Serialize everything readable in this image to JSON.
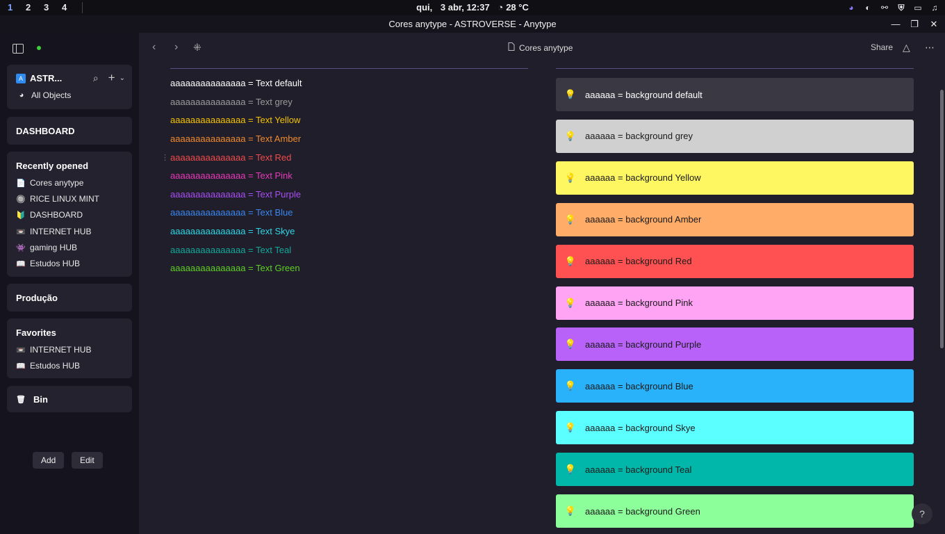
{
  "system_bar": {
    "workspaces": [
      "1",
      "2",
      "3",
      "4"
    ],
    "day": "qui,",
    "date": "3 abr, 12:37",
    "weather": "28 °C"
  },
  "window": {
    "title": "Cores anytype - ASTROVERSE - Anytype",
    "minimize": "—",
    "maximize": "❐",
    "close": "✕"
  },
  "sidebar": {
    "space_name": "ASTR...",
    "all_objects": "All Objects",
    "dashboard": "DASHBOARD",
    "recent_title": "Recently opened",
    "recent": [
      {
        "icon": "📄",
        "label": "Cores anytype"
      },
      {
        "icon": "🔘",
        "label": "RICE LINUX MINT"
      },
      {
        "icon": "🔰",
        "label": "DASHBOARD"
      },
      {
        "icon": "📼",
        "label": "INTERNET HUB"
      },
      {
        "icon": "👾",
        "label": "gaming HUB"
      },
      {
        "icon": "📖",
        "label": "Estudos HUB"
      }
    ],
    "producao": "Produção",
    "favorites_title": "Favorites",
    "favorites": [
      {
        "icon": "📼",
        "label": "INTERNET HUB"
      },
      {
        "icon": "📖",
        "label": "Estudos HUB"
      }
    ],
    "bin": "Bin",
    "add_label": "Add",
    "edit_label": "Edit"
  },
  "header": {
    "doc_title": "Cores anytype",
    "share_label": "Share"
  },
  "text_colors": [
    {
      "text": "aaaaaaaaaaaaaaa = Text default",
      "color": "#ffffff"
    },
    {
      "text": "aaaaaaaaaaaaaaa = Text grey",
      "color": "#9b9b9b"
    },
    {
      "text": "aaaaaaaaaaaaaaa = Text Yellow",
      "color": "#f6c300"
    },
    {
      "text": "aaaaaaaaaaaaaaa = Text Amber",
      "color": "#f18a2e"
    },
    {
      "text": "aaaaaaaaaaaaaaa = Text Red",
      "color": "#f24b4b"
    },
    {
      "text": "aaaaaaaaaaaaaaa = Text Pink",
      "color": "#e83ab9"
    },
    {
      "text": "aaaaaaaaaaaaaaa = Text Purple",
      "color": "#a84ef2"
    },
    {
      "text": "aaaaaaaaaaaaaaa = Text Blue",
      "color": "#3a87f0"
    },
    {
      "text": "aaaaaaaaaaaaaaa = Text Skye",
      "color": "#2fd6e6"
    },
    {
      "text": "aaaaaaaaaaaaaaa = Text Teal",
      "color": "#14a89b"
    },
    {
      "text": "aaaaaaaaaaaaaaa = Text Green",
      "color": "#5fcf25"
    }
  ],
  "background_colors": [
    {
      "text": "aaaaaa = background default",
      "bg": "#393843",
      "fg": "#ffffff"
    },
    {
      "text": "aaaaaa = background grey",
      "bg": "#d0d0d0",
      "fg": "#1a1a1a"
    },
    {
      "text": "aaaaaa = background Yellow",
      "bg": "#fff761",
      "fg": "#1a1a1a"
    },
    {
      "text": "aaaaaa = background Amber",
      "bg": "#ffac69",
      "fg": "#1a1a1a"
    },
    {
      "text": "aaaaaa = background Red",
      "bg": "#ff5151",
      "fg": "#1a1a1a"
    },
    {
      "text": "aaaaaa = background Pink",
      "bg": "#ffa3f5",
      "fg": "#1a1a1a"
    },
    {
      "text": "aaaaaa = background Purple",
      "bg": "#b862fa",
      "fg": "#1a1a1a"
    },
    {
      "text": "aaaaaa = background Blue",
      "bg": "#29b2fa",
      "fg": "#1a1a1a"
    },
    {
      "text": "aaaaaa = background Skye",
      "bg": "#5bffff",
      "fg": "#1a1a1a"
    },
    {
      "text": "aaaaaa = background Teal",
      "bg": "#00b7a9",
      "fg": "#1a1a1a"
    },
    {
      "text": "aaaaaa = background Green",
      "bg": "#8cff9a",
      "fg": "#1a1a1a"
    }
  ],
  "help_label": "?"
}
